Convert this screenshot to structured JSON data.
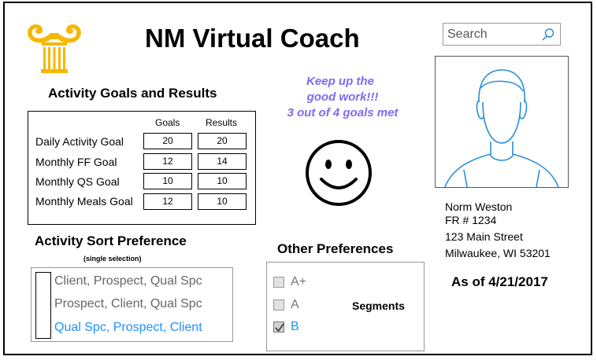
{
  "app": {
    "title": "NM Virtual Coach",
    "logo": "column-capital-logo",
    "brand_color": "#f5b800"
  },
  "search": {
    "placeholder": "Search",
    "icon": "search-icon"
  },
  "activity_goals": {
    "title": "Activity Goals and Results",
    "columns": [
      "Goals",
      "Results"
    ],
    "rows": [
      {
        "label": "Daily Activity Goal",
        "goal": "20",
        "result": "20"
      },
      {
        "label": "Monthly FF Goal",
        "goal": "12",
        "result": "14"
      },
      {
        "label": "Monthly QS Goal",
        "goal": "10",
        "result": "10"
      },
      {
        "label": "Monthly Meals Goal",
        "goal": "12",
        "result": "10"
      }
    ]
  },
  "motivation": {
    "line1": "Keep up the",
    "line2": "good work!!!",
    "line3": "3 out of 4 goals met",
    "color": "#7b6cf0",
    "icon": "smiley-face-icon"
  },
  "profile": {
    "avatar": "person-avatar-icon",
    "name": "Norm Weston",
    "fr_number": "FR # 1234",
    "street": "123 Main Street",
    "city": "Milwaukee, WI 53201",
    "as_of": "As of 4/21/2017"
  },
  "sort_preference": {
    "title": "Activity Sort Preference",
    "subtitle": "(single selection)",
    "options": [
      {
        "label": "Client, Prospect, Qual Spc",
        "selected": false
      },
      {
        "label": "Prospect, Client, Qual Spc",
        "selected": false
      },
      {
        "label": "Qual Spc, Prospect, Client",
        "selected": true
      }
    ],
    "selected_color": "#1e90ff"
  },
  "other_preferences": {
    "title": "Other Preferences",
    "segments_label": "Segments",
    "options": [
      {
        "label": "A+",
        "checked": false
      },
      {
        "label": "A",
        "checked": false
      },
      {
        "label": "B",
        "checked": true
      }
    ]
  }
}
